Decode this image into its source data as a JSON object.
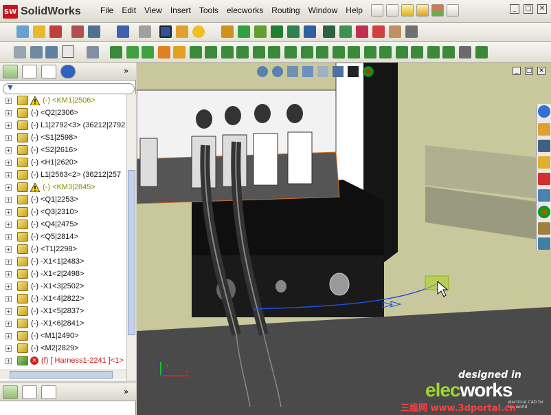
{
  "app": {
    "logo_badge": "SW",
    "logo_text": "SolidWorks"
  },
  "menu": [
    "File",
    "Edit",
    "View",
    "Insert",
    "Tools",
    "elecworks",
    "Routing",
    "Window",
    "Help"
  ],
  "window_controls": [
    "minimize-icon",
    "restore-icon",
    "close-icon"
  ],
  "feature_tree": {
    "filter_icon": "funnel-icon",
    "items": [
      {
        "label": "(-) <KM1|2506>",
        "state": "warning"
      },
      {
        "label": "(-) <Q2|2306>",
        "state": "normal"
      },
      {
        "label": "(-) L1|2792<3> (36212|2792",
        "state": "normal"
      },
      {
        "label": "(-) <S1|2598>",
        "state": "normal"
      },
      {
        "label": "(-) <S2|2616>",
        "state": "normal"
      },
      {
        "label": "(-) <H1|2620>",
        "state": "normal"
      },
      {
        "label": "(-) L1|2563<2> (36212|257",
        "state": "normal"
      },
      {
        "label": "(-) <KM3|2845>",
        "state": "warning"
      },
      {
        "label": "(-) <Q1|2253>",
        "state": "normal"
      },
      {
        "label": "(-) <Q3|2310>",
        "state": "normal"
      },
      {
        "label": "(-) <Q4|2475>",
        "state": "normal"
      },
      {
        "label": "(-) <Q5|2814>",
        "state": "normal"
      },
      {
        "label": "(-) <T1|2298>",
        "state": "normal"
      },
      {
        "label": "(-) -X1<1|2483>",
        "state": "normal"
      },
      {
        "label": "(-) -X1<2|2498>",
        "state": "normal"
      },
      {
        "label": "(-) -X1<3|2502>",
        "state": "normal"
      },
      {
        "label": "(-) -X1<4|2822>",
        "state": "normal"
      },
      {
        "label": "(-) -X1<5|2837>",
        "state": "normal"
      },
      {
        "label": "(-) -X1<6|2841>",
        "state": "normal"
      },
      {
        "label": "(-) <M1|2490>",
        "state": "normal"
      },
      {
        "label": "(-) <M2|2829>",
        "state": "normal"
      },
      {
        "label": "(f) [ Harness1-2241 ]<1>",
        "state": "error"
      }
    ]
  },
  "viewport": {
    "background_color": "#c9c89c",
    "triad": {
      "x": "X",
      "y": "Y",
      "z": "Z"
    }
  },
  "watermark": {
    "designed_in": "designed in",
    "brand_prefix": "elec",
    "brand_suffix": "works",
    "tagline": "electrical CAD for the world",
    "portal": "三维网 www.3dportal.cn"
  }
}
